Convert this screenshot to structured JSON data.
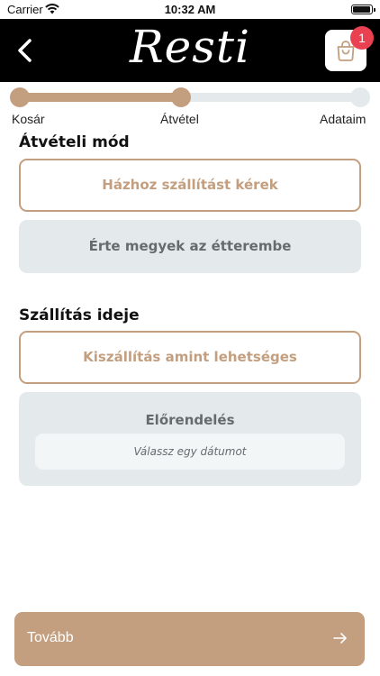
{
  "status_bar": {
    "carrier": "Carrier",
    "time": "10:32 AM"
  },
  "header": {
    "brand": "Resti",
    "cart_count": "1"
  },
  "progress": {
    "fraction_complete": 0.5,
    "steps": [
      {
        "label": "Kosár",
        "state": "done"
      },
      {
        "label": "Átvétel",
        "state": "current"
      },
      {
        "label": "Adataim",
        "state": "todo"
      }
    ]
  },
  "pickup": {
    "title": "Átvételi mód",
    "options": [
      {
        "label": "Házhoz szállítást kérek",
        "selected": true
      },
      {
        "label": "Érte megyek az étterembe",
        "selected": false
      }
    ]
  },
  "delivery_time": {
    "title": "Szállítás ideje",
    "asap_label": "Kiszállítás amint lehetséges",
    "preorder_label": "Előrendelés",
    "date_placeholder": "Válassz egy dátumot"
  },
  "footer": {
    "next_label": "Tovább"
  },
  "colors": {
    "accent": "#c39f80",
    "inactive": "#e4eaec",
    "badge": "#e94052",
    "header": "#000000"
  }
}
